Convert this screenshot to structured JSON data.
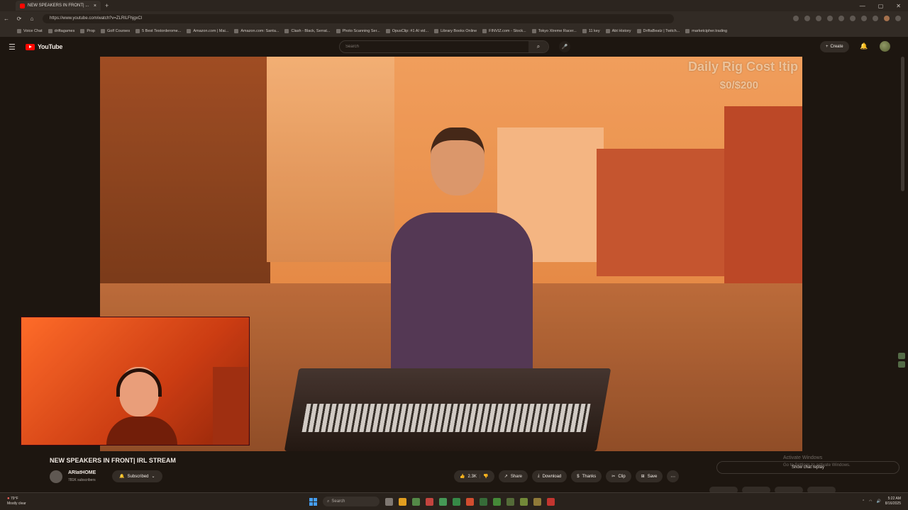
{
  "browser": {
    "tab_title": "NEW SPEAKERS IN FRONT| ...",
    "url": "https://www.youtube.com/watch?v=ZLRlLFhjgxCl",
    "bookmarks": [
      "Voice Chat",
      "driftagames",
      "Prop",
      "Golf Courses",
      "5 Best Testorderome...",
      "Amazon.com | Mai...",
      "Amazon.com: Santa...",
      "Clash - Black, Serrat...",
      "Photo Scanning Ser...",
      "OpusClip: #1 AI vid...",
      "Library Books Online",
      "FINVIZ.com - Stock...",
      "Tokyo Xtreme Racer...",
      "11 key",
      "Abt History",
      "DriftaBeatz | Twitch...",
      "marketcipher.trading"
    ]
  },
  "youtube": {
    "logo_text": "YouTube",
    "search_placeholder": "Search",
    "create_label": "Create"
  },
  "video": {
    "overlay_title": "Daily Rig Cost !tip",
    "overlay_amount": "$0/$200"
  },
  "details": {
    "title": "NEW SPEAKERS IN FRONT| IRL STREAM",
    "channel": "ARIatHOME",
    "subscribers": "781K subscribers",
    "subscribed_label": "Subscribed",
    "likes": "2.3K",
    "share": "Share",
    "download": "Download",
    "thanks": "Thanks",
    "clip": "Clip",
    "save": "Save",
    "chat_replay": "Show chat replay",
    "activate_title": "Activate Windows",
    "activate_sub": "Go to Settings to activate Windows."
  },
  "taskbar": {
    "temp": "79°F",
    "weather": "Mostly clear",
    "search": "Search",
    "time": "5:22 AM",
    "date": "8/16/2025"
  },
  "colors": {
    "youtube_red": "#ff0000",
    "overlay_tint": "#ff8c1e"
  }
}
